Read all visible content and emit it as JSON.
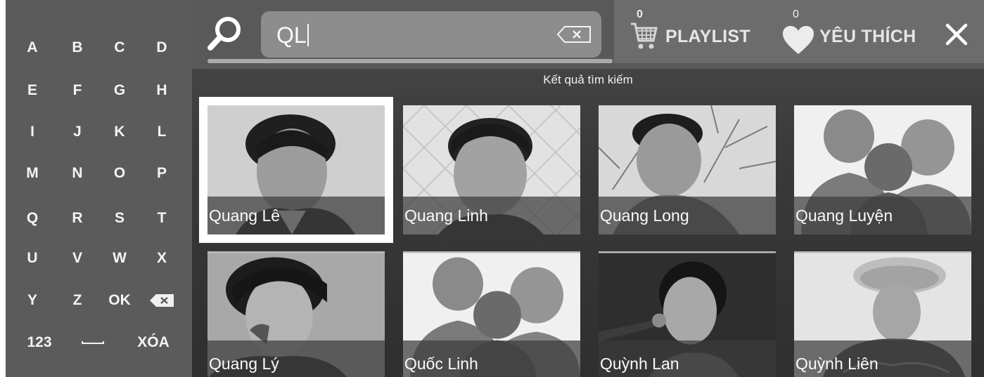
{
  "keyboard": {
    "rows": [
      [
        "A",
        "B",
        "C",
        "D"
      ],
      [
        "E",
        "F",
        "G",
        "H"
      ],
      [
        "I",
        "J",
        "K",
        "L"
      ],
      [
        "M",
        "N",
        "O",
        "P"
      ],
      [
        "Q",
        "R",
        "S",
        "T"
      ],
      [
        "U",
        "V",
        "W",
        "X"
      ],
      [
        "Y",
        "Z",
        "OK",
        "backspace"
      ],
      [
        "123",
        "space",
        "XÓA"
      ]
    ]
  },
  "search": {
    "query": "QL",
    "clear_icon": "backspace-icon",
    "progress": 1.0
  },
  "header": {
    "playlist_count": "0",
    "playlist_label": "PLAYLIST",
    "favorites_count": "0",
    "favorites_label": "YÊU THÍCH",
    "close_icon": "close-icon"
  },
  "results_title": "Kết quả tìm kiếm",
  "results": [
    {
      "name": "Quang Lê",
      "selected": true,
      "photo": "portrait"
    },
    {
      "name": "Quang Linh",
      "selected": false,
      "photo": "portrait"
    },
    {
      "name": "Quang Long",
      "selected": false,
      "photo": "portrait"
    },
    {
      "name": "Quang Luyện",
      "selected": false,
      "photo": "placeholder-people"
    },
    {
      "name": "Quang Lý",
      "selected": false,
      "photo": "portrait"
    },
    {
      "name": "Quốc Linh",
      "selected": false,
      "photo": "placeholder-people"
    },
    {
      "name": "Quỳnh Lan",
      "selected": false,
      "photo": "portrait"
    },
    {
      "name": "Quỳnh Liên",
      "selected": false,
      "photo": "portrait"
    }
  ]
}
